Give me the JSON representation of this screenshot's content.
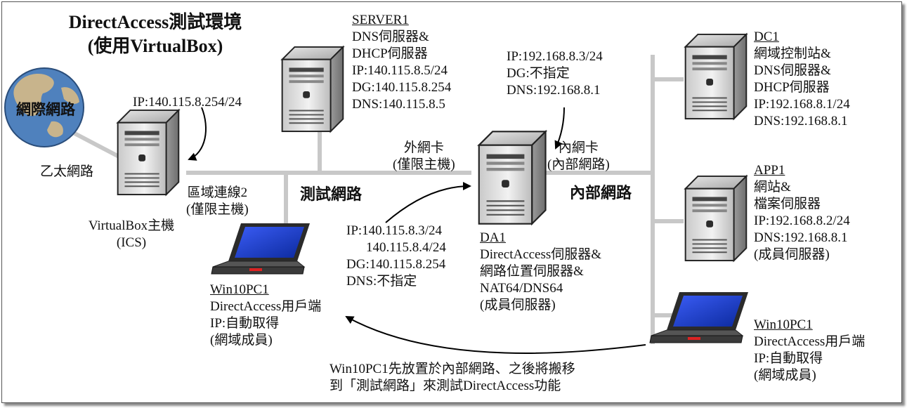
{
  "diagram": {
    "title": {
      "line1": "DirectAccess測試環境",
      "line2": "(使用VirtualBox)"
    },
    "internet": {
      "label": "網際網路"
    },
    "ethernet": {
      "label": "乙太網路"
    },
    "test_network": {
      "label": "測試網路"
    },
    "internal_network": {
      "label": "內部網路"
    },
    "virtualbox_host": {
      "ip": "IP:140.115.8.254/24",
      "nic": "區域連線2",
      "nic_sub": "(僅限主機)",
      "name": "VirtualBox主機",
      "sub": "(ICS)"
    },
    "server1": {
      "name": "SERVER1",
      "lines": [
        "DNS伺服器&",
        "DHCP伺服器",
        "IP:140.115.8.5/24",
        "DG:140.115.8.254",
        "DNS:140.115.8.5"
      ]
    },
    "da1_internal_nic": {
      "ip": "IP:192.168.8.3/24",
      "dg": "DG:不指定",
      "dns": "DNS:192.168.8.1",
      "label": "內網卡",
      "label_sub": "(內部網路)"
    },
    "da1_external_nic": {
      "label": "外網卡",
      "label_sub": "(僅限主機)",
      "ip1": "IP:140.115.8.3/24",
      "ip2": "140.115.8.4/24",
      "dg": "DG:140.115.8.254",
      "dns": "DNS:不指定"
    },
    "da1": {
      "name": "DA1",
      "lines": [
        "DirectAccess伺服器&",
        "網路位置伺服器&",
        "NAT64/DNS64",
        "(成員伺服器)"
      ]
    },
    "dc1": {
      "name": "DC1",
      "lines": [
        "網域控制站&",
        "DNS伺服器&",
        "DHCP伺服器",
        "IP:192.168.8.1/24",
        "DNS:192.168.8.1"
      ]
    },
    "app1": {
      "name": "APP1",
      "lines": [
        "網站&",
        "檔案伺服器",
        "IP:192.168.8.2/24",
        "DNS:192.168.8.1",
        "(成員伺服器)"
      ]
    },
    "win10pc1_test": {
      "name": "Win10PC1",
      "lines": [
        "DirectAccess用戶端",
        "IP:自動取得",
        "(網域成員)"
      ]
    },
    "win10pc1_internal": {
      "name": "Win10PC1",
      "lines": [
        "DirectAccess用戶端",
        "IP:自動取得",
        "(網域成員)"
      ]
    },
    "note": {
      "line1": "Win10PC1先放置於內部網路、之後將搬移",
      "line2": "到「測試網路」來測試DirectAccess功能"
    },
    "colors": {
      "network_line": "#c8c8c8",
      "globe_ocean": "#4f81bd",
      "globe_land": "#c8b48c",
      "laptop_screen": "#1e40d8",
      "laptop_body": "#3a3a3a"
    }
  }
}
